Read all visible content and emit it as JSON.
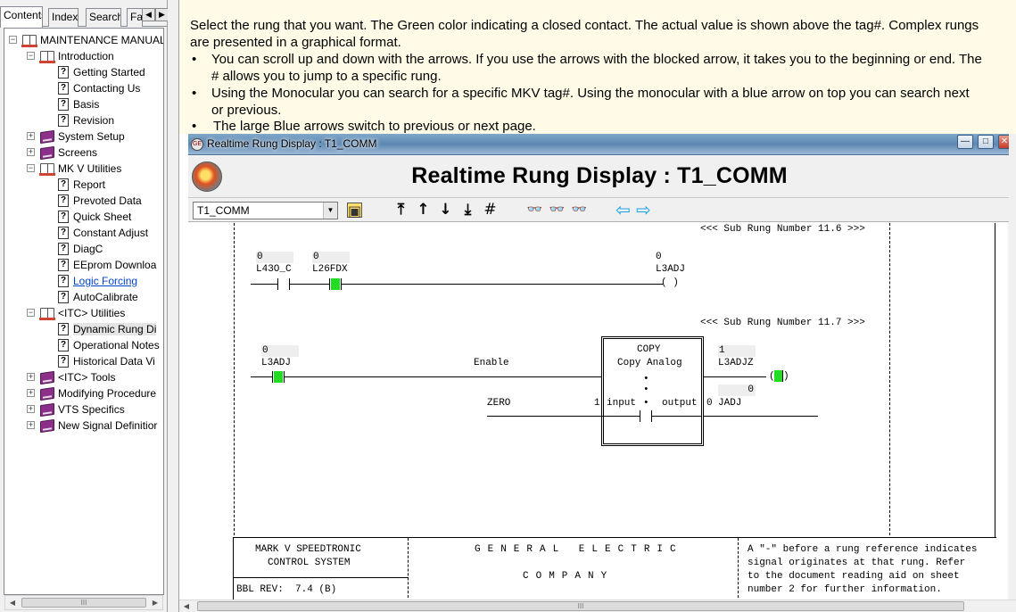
{
  "tabs": [
    {
      "label": "Contents",
      "active": true
    },
    {
      "label": "Index",
      "active": false
    },
    {
      "label": "Search",
      "active": false
    },
    {
      "label": "Fa",
      "active": false
    }
  ],
  "tree": [
    {
      "label": "MAINTENANCE MANUAL",
      "icon": "book-open-icon",
      "expander": "−",
      "level": 0
    },
    {
      "label": "Introduction",
      "icon": "book-open-icon",
      "expander": "−",
      "level": 1
    },
    {
      "label": "Getting Started",
      "icon": "help-page-icon",
      "level": 2
    },
    {
      "label": "Contacting Us",
      "icon": "help-page-icon",
      "level": 2
    },
    {
      "label": "Basis",
      "icon": "help-page-icon",
      "level": 2
    },
    {
      "label": "Revision",
      "icon": "help-page-icon",
      "level": 2
    },
    {
      "label": "System Setup",
      "icon": "book-closed-icon",
      "expander": "+",
      "level": 1
    },
    {
      "label": "Screens",
      "icon": "book-closed-icon",
      "expander": "+",
      "level": 1
    },
    {
      "label": "MK V Utilities",
      "icon": "book-open-icon",
      "expander": "−",
      "level": 1
    },
    {
      "label": "Report",
      "icon": "help-page-icon",
      "level": 2
    },
    {
      "label": "Prevoted Data",
      "icon": "help-page-icon",
      "level": 2
    },
    {
      "label": "Quick Sheet",
      "icon": "help-page-icon",
      "level": 2
    },
    {
      "label": "Constant Adjust",
      "icon": "help-page-icon",
      "level": 2
    },
    {
      "label": "DiagC",
      "icon": "help-page-icon",
      "level": 2
    },
    {
      "label": "EEprom Downloa",
      "icon": "help-page-icon",
      "level": 2
    },
    {
      "label": "Logic Forcing",
      "icon": "help-page-icon",
      "level": 2,
      "link": true
    },
    {
      "label": "AutoCalibrate",
      "icon": "help-page-icon",
      "level": 2
    },
    {
      "label": "<ITC> Utilities",
      "icon": "book-open-icon",
      "expander": "−",
      "level": 1
    },
    {
      "label": "Dynamic Rung Di",
      "icon": "help-page-icon",
      "level": 2,
      "selected": true
    },
    {
      "label": "Operational Notes",
      "icon": "help-page-icon",
      "level": 2
    },
    {
      "label": "Historical Data Vi",
      "icon": "help-page-icon",
      "level": 2
    },
    {
      "label": "<ITC> Tools",
      "icon": "book-closed-icon",
      "expander": "+",
      "level": 1
    },
    {
      "label": "Modifying Procedure",
      "icon": "book-closed-icon",
      "expander": "+",
      "level": 1
    },
    {
      "label": "VTS Specifics",
      "icon": "book-closed-icon",
      "expander": "+",
      "level": 1
    },
    {
      "label": "New Signal Definitior",
      "icon": "book-closed-icon",
      "expander": "+",
      "level": 1
    }
  ],
  "instructions": {
    "line1": "Select the rung that you want. The Green color indicating a closed contact. The actual value is shown above the tag#. Complex rungs",
    "line2": "are presented in a graphical format.",
    "bullet1_a": "You can scroll up and down with the arrows. If you use the arrows with the blocked arrow, it takes you to the beginning or end. The",
    "bullet1_b": "# allows you to jump to a specific rung.",
    "bullet2_a": "Using the Monocular you can  search for a specific MKV tag#. Using the monocular with a blue arrow on top you can search next",
    "bullet2_b": "or previous.",
    "bullet3": "The large Blue arrows switch to previous or next page.",
    "bullet_char": "•"
  },
  "window": {
    "title": "Realtime Rung Display : T1_COMM",
    "display_title": "Realtime Rung Display : T1_COMM",
    "minimize": "—",
    "maximize": "□",
    "close": "✕"
  },
  "toolbar": {
    "selected_rung": "T1_COMM",
    "dropdown_arrow": "▼",
    "buttons": [
      {
        "name": "print-icon",
        "glyph": "▣"
      },
      {
        "name": "first-rung-icon",
        "glyph": "⤒"
      },
      {
        "name": "up-arrow-icon",
        "glyph": "↑"
      },
      {
        "name": "down-arrow-icon",
        "glyph": "↓"
      },
      {
        "name": "last-rung-icon",
        "glyph": "⤓"
      },
      {
        "name": "jump-to-rung-icon",
        "glyph": "#"
      },
      {
        "name": "binoculars-search-icon",
        "glyph": "👓"
      },
      {
        "name": "binoculars-search-next-icon",
        "glyph": "👓"
      },
      {
        "name": "binoculars-search-prev-icon",
        "glyph": "👓"
      },
      {
        "name": "previous-page-icon",
        "glyph": "⇦"
      },
      {
        "name": "next-page-icon",
        "glyph": "⇨"
      }
    ]
  },
  "ladder": {
    "subrung1": "<<< Sub Rung Number 11.6 >>>",
    "subrung2": "<<< Sub Rung Number 11.7 >>>",
    "r1_c1_value": "0",
    "r1_c1_tag": "L43O_C",
    "r1_c2_value": "0",
    "r1_c2_tag": "L26FDX",
    "r1_coil_value": "0",
    "r1_coil_tag": "L3ADJ",
    "r1_coil_symbol": "( )",
    "r2_c1_value": "0",
    "r2_c1_tag": "L3ADJ",
    "r2_enable": "Enable",
    "block_title": "COPY",
    "block_subtitle": "Copy Analog",
    "block_input": "input",
    "block_output": "output",
    "block_dot": "•",
    "r2_coil_value": "1",
    "r2_coil_tag": "L3ADJZ",
    "r2_coil_open": "(",
    "r2_coil_close": ")",
    "input_tag": "ZERO",
    "input_value": "1",
    "output_value": "0",
    "output_tag": "JADJ",
    "output_tag_value": "0"
  },
  "footer": {
    "system_line1": "MARK V SPEEDTRONIC",
    "system_line2": "CONTROL SYSTEM",
    "company_line1": "GENERAL ELECTRIC",
    "company_line2": "COMPANY",
    "note_line1": "A \"-\" before a rung reference indicates",
    "note_line2": "signal originates at that rung. Refer",
    "note_line3": "to the document reading aid on sheet",
    "note_line4": "number 2 for further information.",
    "rev": "BBL REV:  7.4 (B)"
  },
  "scroll": {
    "left": "◀",
    "right": "▶",
    "thumb": "III"
  },
  "colors": {
    "instructions_bg": "#fffbe6",
    "closed_contact": "#22dd22",
    "nav_arrow": "#1aa3e8"
  }
}
